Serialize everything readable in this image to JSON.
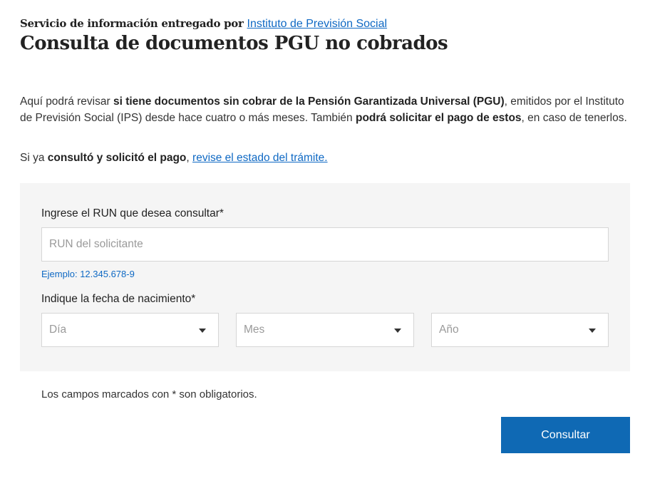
{
  "header": {
    "provider_prefix": "Servicio de información entregado por",
    "provider_link": "Instituto de Previsión Social",
    "title": "Consulta de documentos PGU no cobrados"
  },
  "intro": {
    "p1_a": "Aquí podrá revisar ",
    "p1_b": "si tiene documentos sin cobrar de la Pensión Garantizada Universal (PGU)",
    "p1_c": ", emitidos por el Instituto de Previsión Social (IPS) desde hace cuatro o más meses. También ",
    "p1_d": "podrá solicitar el pago de estos",
    "p1_e": ", en caso de tenerlos.",
    "p2_a": "Si ya ",
    "p2_b": "consultó y solicitó el pago",
    "p2_c": ", ",
    "p2_link": "revise el estado del trámite."
  },
  "form": {
    "run_label": "Ingrese el RUN que desea consultar*",
    "run_placeholder": "RUN del solicitante",
    "run_example": "Ejemplo: 12.345.678-9",
    "birth_label": "Indique la fecha de nacimiento*",
    "day_placeholder": "Día",
    "month_placeholder": "Mes",
    "year_placeholder": "Año"
  },
  "footer": {
    "required_note": "Los campos marcados con * son obligatorios.",
    "submit_label": "Consultar"
  }
}
